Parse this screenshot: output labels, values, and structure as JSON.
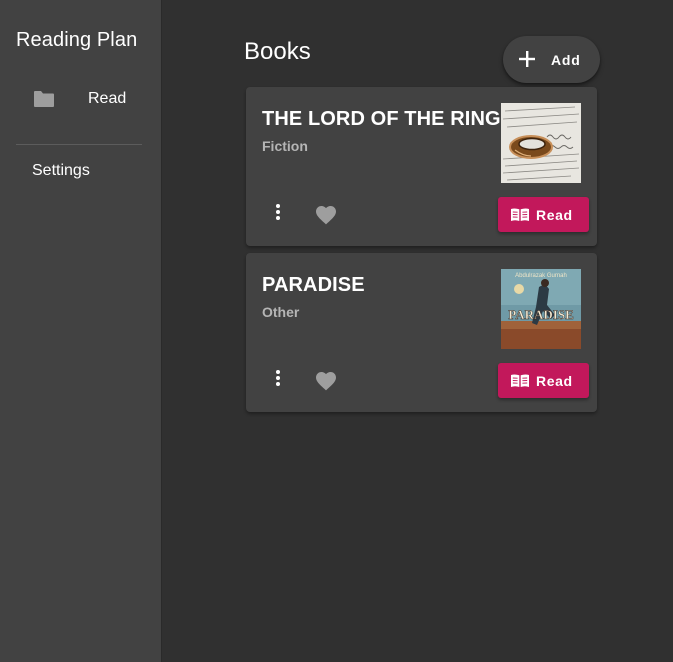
{
  "app": {
    "title": "Reading Plan"
  },
  "sidebar": {
    "items": [
      {
        "label": "Read",
        "icon": "folder-icon"
      }
    ],
    "settings_label": "Settings"
  },
  "main": {
    "title": "Books",
    "add_label": "Add"
  },
  "books": [
    {
      "title": "THE LORD OF THE RING",
      "category": "Fiction",
      "read_label": "Read",
      "cover": "ring-on-manuscript-image"
    },
    {
      "title": "PARADISE",
      "category": "Other",
      "read_label": "Read",
      "cover": "paradise-book-cover-image",
      "cover_text": "PARADISE",
      "cover_author": "Abdulrazak Gurnah"
    }
  ],
  "colors": {
    "background": "#303030",
    "surface": "#424242",
    "accent": "#c2185b",
    "muted_text": "#b5b5b5",
    "icon": "#9e9e9e"
  }
}
